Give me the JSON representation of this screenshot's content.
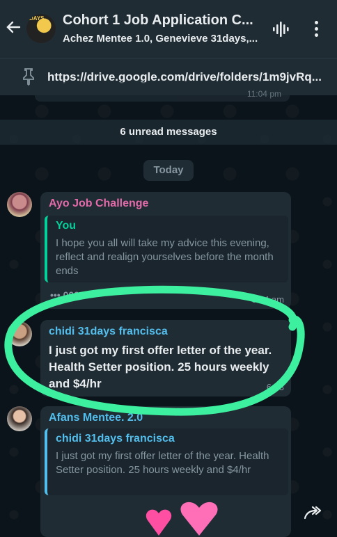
{
  "header": {
    "title": "Cohort 1 Job Application C...",
    "subtitle": "Achez Mentee 1.0, Genevieve 31days,...",
    "avatar_tag": "DAYS"
  },
  "pinned": {
    "text": "https://drive.google.com/drive/folders/1m9jvRq..."
  },
  "faded_message": {
    "time": "11:04 pm"
  },
  "unread_banner": "6 unread messages",
  "day_label": "Today",
  "messages": [
    {
      "sender": "Ayo Job Challenge",
      "sender_color": "#e26ba9",
      "quote": {
        "name": "You",
        "name_color": "#06cf9c",
        "text": "I hope you all will take my advice this evening, reflect and realign yourselves before the month ends"
      },
      "truncated": "••• 000",
      "time": "6:24 am"
    },
    {
      "sender": "chidi 31days francisca",
      "sender_color": "#53bdeb",
      "text": "I just got my first offer letter of the year. Health Setter position. 25 hours weekly and $4/hr",
      "time": "6:33"
    },
    {
      "sender": "Afans Mentee. 2.0",
      "sender_color": "#53bdeb",
      "quote": {
        "name": "chidi 31days francisca",
        "name_color": "#53bdeb",
        "text": "I just got my first offer letter of the year. Health Setter position. 25 hours weekly and $4/hr"
      }
    }
  ],
  "colors": {
    "highlight": "#3df0a0",
    "header_bg": "#1f2c34",
    "chat_bg": "#0b141a"
  },
  "icons": [
    "back-arrow-icon",
    "voice-call-icon",
    "more-options-icon",
    "pin-icon",
    "heart-icon",
    "forward-icon"
  ]
}
